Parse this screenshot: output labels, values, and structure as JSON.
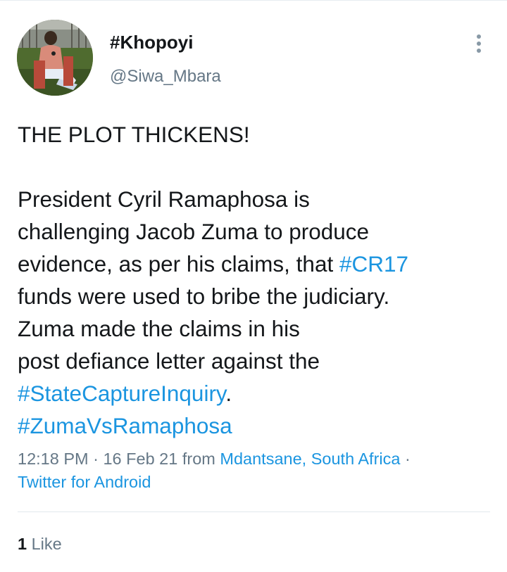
{
  "author": {
    "display_name": "#Khopoyi",
    "handle": "@Siwa_Mbara",
    "avatar_icon": "profile-photo"
  },
  "tweet": {
    "lines": [
      [
        {
          "text": "THE PLOT THICKENS!"
        }
      ],
      [],
      [
        {
          "text": "President Cyril Ramaphosa is"
        }
      ],
      [
        {
          "text": "challenging Jacob Zuma to produce"
        }
      ],
      [
        {
          "text": "evidence, as per his claims, that "
        },
        {
          "text": "#CR17",
          "hashtag": true
        }
      ],
      [
        {
          "text": "funds were used to bribe the judiciary."
        }
      ],
      [
        {
          "text": "Zuma made the claims in his"
        }
      ],
      [
        {
          "text": "post defiance letter against the"
        }
      ],
      [
        {
          "text": "#StateCaptureInquiry",
          "hashtag": true
        },
        {
          "text": "."
        }
      ],
      [
        {
          "text": "#ZumaVsRamaphosa",
          "hashtag": true
        }
      ]
    ]
  },
  "meta": {
    "time": "12:18 PM",
    "separator": " · ",
    "date": "16 Feb 21",
    "from_label": " from ",
    "location": "Mdantsane, South Africa",
    "trailing_separator": " ·",
    "client": "Twitter for Android"
  },
  "engagement": {
    "likes_count": "1",
    "likes_label": " Like"
  },
  "colors": {
    "link": "#1b95e0",
    "secondary_text": "#657786",
    "primary_text": "#14171a"
  }
}
